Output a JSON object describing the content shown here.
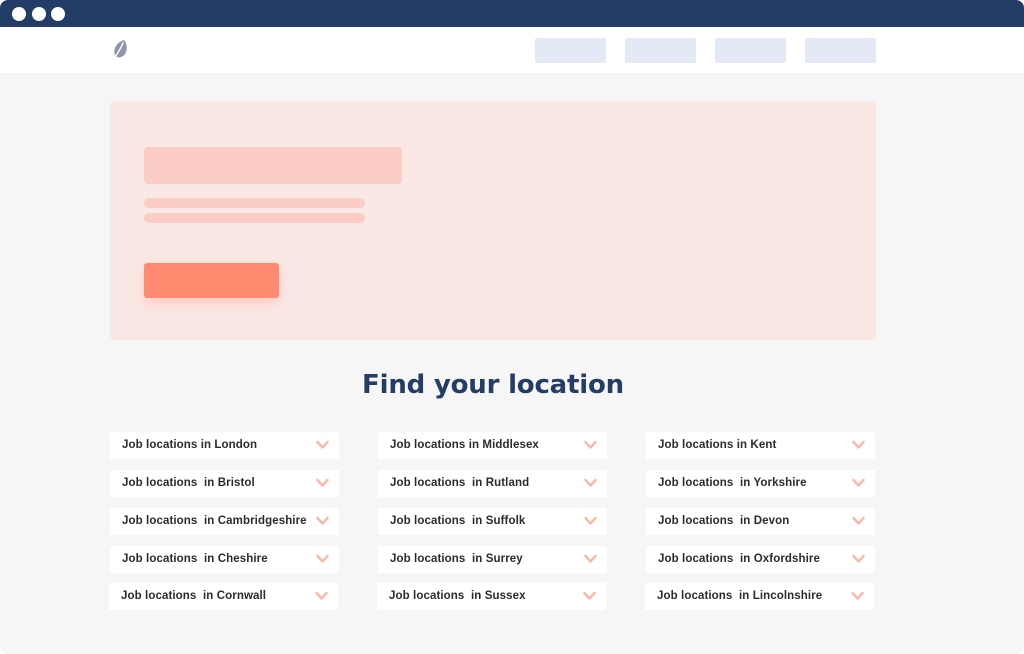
{
  "section": {
    "title": "Find your location"
  },
  "locations": [
    {
      "label": "Job locations in London"
    },
    {
      "label": "Job locations in Middlesex"
    },
    {
      "label": "Job locations in Kent"
    },
    {
      "label": "Job locations  in Bristol"
    },
    {
      "label": "Job locations  in Rutland"
    },
    {
      "label": "Job locations  in Yorkshire"
    },
    {
      "label": "Job locations  in Cambridgeshire"
    },
    {
      "label": "Job locations  in Suffolk"
    },
    {
      "label": "Job locations  in Devon"
    },
    {
      "label": "Job locations  in Cheshire"
    },
    {
      "label": "Job locations  in Surrey"
    },
    {
      "label": "Job locations  in Oxfordshire"
    },
    {
      "label": "Job locations  in Cornwall"
    },
    {
      "label": "Job locations  in Sussex"
    },
    {
      "label": "Job locations  in Lincolnshire"
    }
  ],
  "icons": {
    "logo": "leaf-icon",
    "dropdown": "chevron-down-icon"
  },
  "colors": {
    "titlebar": "#233d66",
    "heading": "#233d66",
    "hero_background": "#fae8e5",
    "hero_placeholder": "#fbcdc6",
    "accent_button": "#ff8a70",
    "chevron": "#ffb3a1",
    "nav_placeholder": "#e4eaf5"
  }
}
